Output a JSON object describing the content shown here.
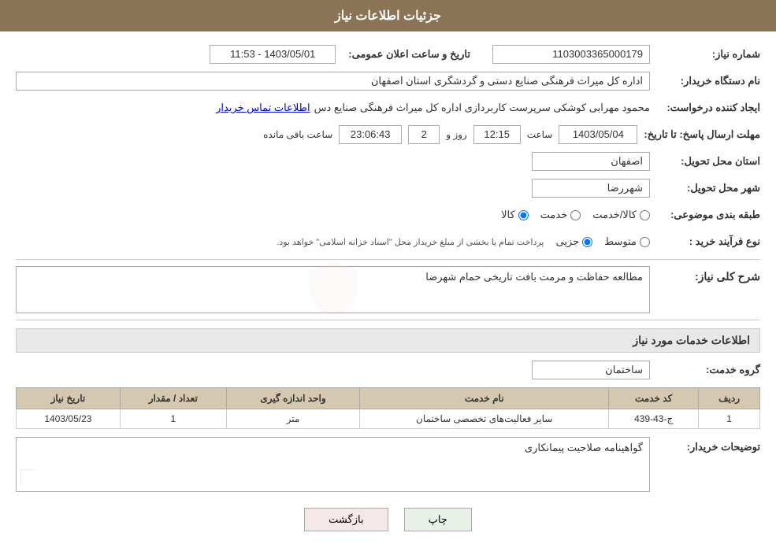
{
  "header": {
    "title": "جزئیات اطلاعات نیاز"
  },
  "fields": {
    "order_number_label": "شماره نیاز:",
    "order_number_value": "1103003365000179",
    "announcement_date_label": "تاریخ و ساعت اعلان عمومی:",
    "announcement_date_value": "1403/05/01 - 11:53",
    "buyer_org_label": "نام دستگاه خریدار:",
    "buyer_org_value": "اداره کل میراث فرهنگی  صنایع دستی و گردشگری استان اصفهان",
    "requester_label": "ایجاد کننده درخواست:",
    "requester_value": "محمود مهرابی کوشکی سرپرست کاربردازی اداره کل میراث فرهنگی  صنایع دس",
    "requester_link": "اطلاعات تماس خریدار",
    "response_deadline_label": "مهلت ارسال پاسخ: تا تاریخ:",
    "response_date": "1403/05/04",
    "response_time_label": "ساعت",
    "response_time": "12:15",
    "response_day_label": "روز و",
    "response_days": "2",
    "response_remaining_label": "ساعت باقی مانده",
    "response_remaining": "23:06:43",
    "delivery_province_label": "استان محل تحویل:",
    "delivery_province_value": "اصفهان",
    "delivery_city_label": "شهر محل تحویل:",
    "delivery_city_value": "شهررضا",
    "category_label": "طبقه بندی موضوعی:",
    "category_options": [
      "کالا",
      "خدمت",
      "کالا/خدمت"
    ],
    "category_selected": "کالا",
    "purchase_type_label": "نوع فرآیند خرید :",
    "purchase_type_options": [
      "جزیی",
      "متوسط"
    ],
    "purchase_type_selected": "متوسط",
    "purchase_note": "پرداخت تمام یا بخشی از مبلغ خریداز محل \"اسناد خزانه اسلامی\" خواهد بود.",
    "need_description_label": "شرح کلی نیاز:",
    "need_description_value": "مطالعه حفاظت و مرمت بافت تاریخی حمام شهرضا",
    "services_section_label": "اطلاعات خدمات مورد نیاز",
    "service_group_label": "گروه خدمت:",
    "service_group_value": "ساختمان",
    "table_headers": {
      "row_num": "ردیف",
      "service_code": "کد خدمت",
      "service_name": "نام خدمت",
      "unit": "واحد اندازه گیری",
      "quantity": "تعداد / مقدار",
      "date": "تاریخ نیاز"
    },
    "table_rows": [
      {
        "row_num": "1",
        "service_code": "ج-43-439",
        "service_name": "سایر فعالیت‌های تخصصی ساختمان",
        "unit": "متر",
        "quantity": "1",
        "date": "1403/05/23"
      }
    ],
    "buyer_notes_label": "توضیحات خریدار:",
    "buyer_notes_value": "گواهینامه صلاحیت پیمانکاری"
  },
  "buttons": {
    "print_label": "چاپ",
    "back_label": "بازگشت"
  }
}
